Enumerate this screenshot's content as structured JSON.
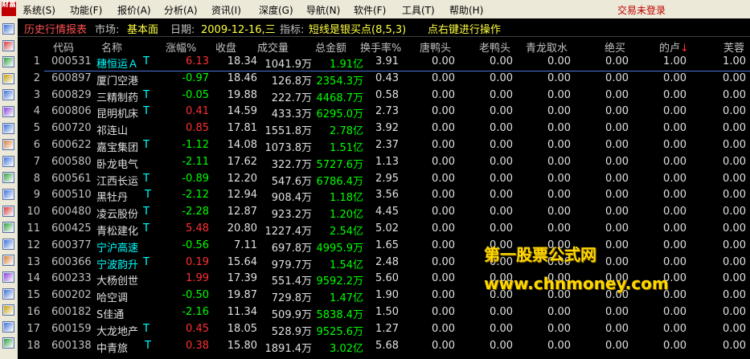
{
  "menu": {
    "logo": "财富",
    "items": [
      "系统(S)",
      "功能(F)",
      "报价(A)",
      "分析(A)",
      "资讯(I)",
      "深度(G)",
      "导航(N)",
      "软件(F)",
      "工具(T)",
      "帮助(H)"
    ],
    "trade_status": "交易未登录"
  },
  "toolbar": {
    "icons": [
      "quote-list-icon",
      "kline-icon",
      "trend-icon",
      "candles-icon",
      "report-icon",
      "table-icon",
      "grid-icon",
      "news-icon",
      "mail-icon",
      "people-icon",
      "finance-icon",
      "calc-icon",
      "etf-icon",
      "doc-icon",
      "note-icon",
      "edit-icon",
      "window-icon",
      "folder-icon",
      "tools-icon",
      "screen-icon"
    ]
  },
  "titlebar": {
    "title": "历史行情报表",
    "market_label": "市场:",
    "market_value": "基本面",
    "date_label": "日期:",
    "date_value": "2009-12-16,三",
    "indicator_label": "指标:",
    "indicator_value": "短线是银买点(8,5,3)",
    "hint": "点右键进行操作"
  },
  "columns": [
    "代码",
    "名称",
    "涨幅%",
    "收盘",
    "成交量",
    "总金额",
    "换手率%",
    "唐鸭头",
    "老鸭头",
    "青龙取水",
    "绝买",
    "的卢",
    "芙蓉"
  ],
  "sort_arrow": "↓",
  "rows": [
    {
      "no": "1",
      "code": "000531",
      "name": "穗恒运Ａ",
      "tag": "T",
      "name_color": "#00ffff",
      "chg": "6.13",
      "chg_color": "#ff3030",
      "close": "18.34",
      "vol": "1041.9万",
      "amt": "1.91亿",
      "amt_color": "#00ff00",
      "turn": "3.91",
      "c1": "0.00",
      "c2": "0.00",
      "c3": "0.00",
      "c4": "0.00",
      "c5": "1.00",
      "c6": "1.00"
    },
    {
      "no": "2",
      "code": "600897",
      "name": "厦门空港",
      "tag": "",
      "name_color": "#e0e0e0",
      "chg": "-0.97",
      "chg_color": "#00ff00",
      "close": "18.46",
      "vol": "126.8万",
      "amt": "2354.3万",
      "amt_color": "#00ff00",
      "turn": "0.43",
      "c1": "0.00",
      "c2": "0.00",
      "c3": "0.00",
      "c4": "0.00",
      "c5": "0.00",
      "c6": "0.00"
    },
    {
      "no": "3",
      "code": "600829",
      "name": "三精制药",
      "tag": "T",
      "name_color": "#e0e0e0",
      "chg": "-0.05",
      "chg_color": "#00ff00",
      "close": "19.88",
      "vol": "222.7万",
      "amt": "4468.7万",
      "amt_color": "#00ff00",
      "turn": "0.58",
      "c1": "0.00",
      "c2": "0.00",
      "c3": "0.00",
      "c4": "0.00",
      "c5": "0.00",
      "c6": "0.00"
    },
    {
      "no": "4",
      "code": "600806",
      "name": "昆明机床",
      "tag": "T",
      "name_color": "#e0e0e0",
      "chg": "0.41",
      "chg_color": "#ff3030",
      "close": "14.59",
      "vol": "433.3万",
      "amt": "6295.0万",
      "amt_color": "#00ff00",
      "turn": "2.73",
      "c1": "0.00",
      "c2": "0.00",
      "c3": "0.00",
      "c4": "0.00",
      "c5": "0.00",
      "c6": "0.00"
    },
    {
      "no": "5",
      "code": "600720",
      "name": "祁连山",
      "tag": "",
      "name_color": "#e0e0e0",
      "chg": "0.85",
      "chg_color": "#ff3030",
      "close": "17.81",
      "vol": "1551.8万",
      "amt": "2.78亿",
      "amt_color": "#00ff00",
      "turn": "3.92",
      "c1": "0.00",
      "c2": "0.00",
      "c3": "0.00",
      "c4": "0.00",
      "c5": "0.00",
      "c6": "0.00"
    },
    {
      "no": "6",
      "code": "600622",
      "name": "嘉宝集团",
      "tag": "T",
      "name_color": "#e0e0e0",
      "chg": "-1.12",
      "chg_color": "#00ff00",
      "close": "14.08",
      "vol": "1073.8万",
      "amt": "1.51亿",
      "amt_color": "#00ff00",
      "turn": "2.37",
      "c1": "0.00",
      "c2": "0.00",
      "c3": "0.00",
      "c4": "0.00",
      "c5": "0.00",
      "c6": "0.00"
    },
    {
      "no": "7",
      "code": "600580",
      "name": "卧龙电气",
      "tag": "",
      "name_color": "#e0e0e0",
      "chg": "-2.11",
      "chg_color": "#00ff00",
      "close": "17.62",
      "vol": "322.7万",
      "amt": "5727.6万",
      "amt_color": "#00ff00",
      "turn": "1.13",
      "c1": "0.00",
      "c2": "0.00",
      "c3": "0.00",
      "c4": "0.00",
      "c5": "0.00",
      "c6": "0.00"
    },
    {
      "no": "8",
      "code": "600561",
      "name": "江西长运",
      "tag": "T",
      "name_color": "#e0e0e0",
      "chg": "-0.89",
      "chg_color": "#00ff00",
      "close": "12.20",
      "vol": "547.6万",
      "amt": "6786.4万",
      "amt_color": "#00ff00",
      "turn": "2.95",
      "c1": "0.00",
      "c2": "0.00",
      "c3": "0.00",
      "c4": "0.00",
      "c5": "0.00",
      "c6": "0.00"
    },
    {
      "no": "9",
      "code": "600510",
      "name": "黑牡丹",
      "tag": "T",
      "name_color": "#e0e0e0",
      "chg": "-2.12",
      "chg_color": "#00ff00",
      "close": "12.94",
      "vol": "908.4万",
      "amt": "1.18亿",
      "amt_color": "#00ff00",
      "turn": "3.56",
      "c1": "0.00",
      "c2": "0.00",
      "c3": "0.00",
      "c4": "0.00",
      "c5": "0.00",
      "c6": "0.00"
    },
    {
      "no": "10",
      "code": "600480",
      "name": "凌云股份",
      "tag": "T",
      "name_color": "#e0e0e0",
      "chg": "-2.28",
      "chg_color": "#00ff00",
      "close": "12.87",
      "vol": "923.2万",
      "amt": "1.20亿",
      "amt_color": "#00ff00",
      "turn": "4.45",
      "c1": "0.00",
      "c2": "0.00",
      "c3": "0.00",
      "c4": "0.00",
      "c5": "0.00",
      "c6": "0.00"
    },
    {
      "no": "11",
      "code": "600425",
      "name": "青松建化",
      "tag": "T",
      "name_color": "#e0e0e0",
      "chg": "5.48",
      "chg_color": "#ff3030",
      "close": "20.80",
      "vol": "1227.4万",
      "amt": "2.54亿",
      "amt_color": "#00ff00",
      "turn": "5.02",
      "c1": "0.00",
      "c2": "0.00",
      "c3": "0.00",
      "c4": "0.00",
      "c5": "0.00",
      "c6": "0.00"
    },
    {
      "no": "12",
      "code": "600377",
      "name": "宁沪高速",
      "tag": "",
      "name_color": "#00ffff",
      "chg": "-0.56",
      "chg_color": "#00ff00",
      "close": "7.11",
      "vol": "697.8万",
      "amt": "4995.9万",
      "amt_color": "#00ff00",
      "turn": "1.65",
      "c1": "0.00",
      "c2": "0.00",
      "c3": "0.00",
      "c4": "0.00",
      "c5": "0.00",
      "c6": "0.00"
    },
    {
      "no": "13",
      "code": "600366",
      "name": "宁波韵升",
      "tag": "T",
      "name_color": "#00ffff",
      "chg": "0.19",
      "chg_color": "#ff3030",
      "close": "15.64",
      "vol": "979.7万",
      "amt": "1.54亿",
      "amt_color": "#00ff00",
      "turn": "2.48",
      "c1": "0.00",
      "c2": "0.00",
      "c3": "0.00",
      "c4": "0.00",
      "c5": "0.00",
      "c6": "0.00"
    },
    {
      "no": "14",
      "code": "600233",
      "name": "大杨创世",
      "tag": "",
      "name_color": "#e0e0e0",
      "chg": "1.99",
      "chg_color": "#ff3030",
      "close": "17.39",
      "vol": "551.4万",
      "amt": "9592.2万",
      "amt_color": "#00ff00",
      "turn": "5.60",
      "c1": "0.00",
      "c2": "0.00",
      "c3": "0.00",
      "c4": "0.00",
      "c5": "0.00",
      "c6": "0.00"
    },
    {
      "no": "15",
      "code": "600202",
      "name": "哈空调",
      "tag": "",
      "name_color": "#e0e0e0",
      "chg": "-0.50",
      "chg_color": "#00ff00",
      "close": "19.87",
      "vol": "729.8万",
      "amt": "1.47亿",
      "amt_color": "#00ff00",
      "turn": "1.90",
      "c1": "0.00",
      "c2": "0.00",
      "c3": "0.00",
      "c4": "0.00",
      "c5": "0.00",
      "c6": "0.00"
    },
    {
      "no": "16",
      "code": "600182",
      "name": "S佳通",
      "tag": "",
      "name_color": "#e0e0e0",
      "chg": "-2.16",
      "chg_color": "#00ff00",
      "close": "11.34",
      "vol": "509.9万",
      "amt": "5838.4万",
      "amt_color": "#00ff00",
      "turn": "1.50",
      "c1": "0.00",
      "c2": "0.00",
      "c3": "0.00",
      "c4": "0.00",
      "c5": "0.00",
      "c6": "0.00"
    },
    {
      "no": "17",
      "code": "600159",
      "name": "大龙地产",
      "tag": "T",
      "name_color": "#e0e0e0",
      "chg": "0.45",
      "chg_color": "#ff3030",
      "close": "18.05",
      "vol": "528.9万",
      "amt": "9525.6万",
      "amt_color": "#00ff00",
      "turn": "1.27",
      "c1": "0.00",
      "c2": "0.00",
      "c3": "0.00",
      "c4": "0.00",
      "c5": "0.00",
      "c6": "0.00"
    },
    {
      "no": "18",
      "code": "600138",
      "name": "中青旅",
      "tag": "T",
      "name_color": "#e0e0e0",
      "chg": "0.38",
      "chg_color": "#ff3030",
      "close": "15.80",
      "vol": "1891.4万",
      "amt": "3.02亿",
      "amt_color": "#00ff00",
      "turn": "5.68",
      "c1": "0.00",
      "c2": "0.00",
      "c3": "0.00",
      "c4": "0.00",
      "c5": "0.00",
      "c6": "0.00"
    }
  ],
  "watermark": {
    "line1": "第一股票公式网",
    "line2": "www.chnmoney.com"
  }
}
